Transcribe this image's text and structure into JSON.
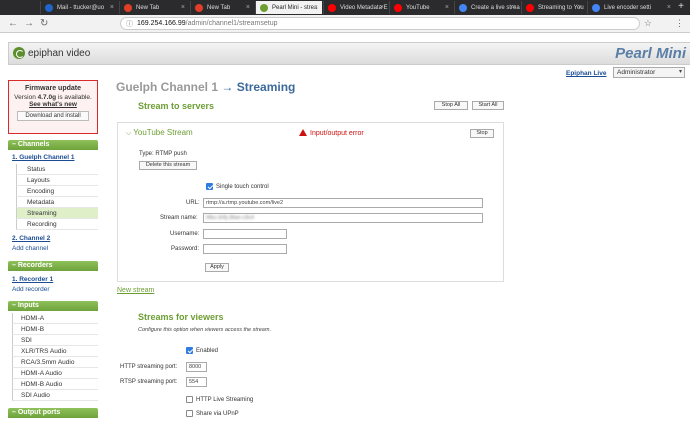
{
  "browser": {
    "tabs": [
      {
        "label": "Mail - ttucker@uo",
        "color": "#1f64c7"
      },
      {
        "label": "New Tab",
        "color": "#e23d28"
      },
      {
        "label": "New Tab",
        "color": "#e23d28"
      },
      {
        "label": "Pearl Mini - strea",
        "color": "#6d9e34"
      },
      {
        "label": "Video Metadata E",
        "color": "#ff0000"
      },
      {
        "label": "YouTube",
        "color": "#ff0000"
      },
      {
        "label": "Create a live strea",
        "color": "#4285f4"
      },
      {
        "label": "Streaming to You",
        "color": "#ff0000"
      },
      {
        "label": "Live encoder setti",
        "color": "#4285f4"
      }
    ],
    "url_host": "169.254.166.99",
    "url_path": "/admin/channel1/streamsetup"
  },
  "header": {
    "logo_text": "epiphan video",
    "product": "Pearl Mini"
  },
  "top": {
    "epiphan_live": "Epiphan Live",
    "admin": "Administrator"
  },
  "firmware": {
    "title": "Firmware update",
    "line_pre": "Version ",
    "version": "4.7.0g",
    "line_post": " is available.",
    "whats_new": "See what's new",
    "button": "Download and install"
  },
  "sidebar": {
    "channels_title": "Channels",
    "channel1": "1. Guelph Channel 1",
    "channel1_items": [
      "Status",
      "Layouts",
      "Encoding",
      "Metadata",
      "Streaming",
      "Recording"
    ],
    "channel2": "2. Channel 2",
    "add_channel": "Add channel",
    "recorders_title": "Recorders",
    "recorder1": "1. Recorder 1",
    "add_recorder": "Add recorder",
    "inputs_title": "Inputs",
    "inputs": [
      "HDMI-A",
      "HDMI-B",
      "SDI",
      "XLR/TRS Audio",
      "RCA/3.5mm Audio",
      "HDMI-A Audio",
      "HDMI-B Audio",
      "SDI Audio"
    ],
    "output_title": "Output ports"
  },
  "main": {
    "title_channel": "Guelph Channel 1",
    "title_arrow": " → ",
    "title_page": "Streaming",
    "stream_to_servers": "Stream to servers",
    "stop_all": "Stop All",
    "start_all": "Start All",
    "stream": {
      "name": "YouTube Stream",
      "error": "Input/output error",
      "stop": "Stop",
      "type": "Type: RTMP push",
      "delete": "Delete this stream",
      "single_touch": "Single touch control",
      "url_label": "URL:",
      "url_value": "rtmp://a.rtmp.youtube.com/live2",
      "name_label": "Stream name:",
      "name_value": "hfks-3r9j-3fwe-c9c4",
      "user_label": "Username:",
      "pass_label": "Password:",
      "apply": "Apply"
    },
    "new_stream": "New stream",
    "viewers_title": "Streams for viewers",
    "viewers_note": "Configure this option when viewers access the stream.",
    "enabled": "Enabled",
    "http_label": "HTTP streaming port:",
    "http_value": "8000",
    "rtsp_label": "RTSP streaming port:",
    "rtsp_value": "554",
    "hls": "HTTP Live Streaming",
    "upnp": "Share via UPnP"
  }
}
